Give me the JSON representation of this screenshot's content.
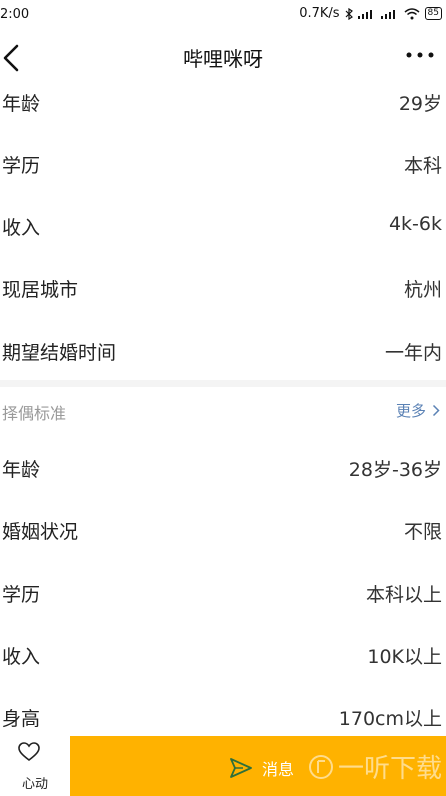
{
  "status_bar": {
    "time": "2:00",
    "network_speed": "0.7K/s",
    "battery": "85"
  },
  "nav": {
    "title": "哔哩咪呀"
  },
  "profile_rows": [
    {
      "label": "年龄",
      "value": "29岁"
    },
    {
      "label": "学历",
      "value": "本科"
    },
    {
      "label": "收入",
      "value": "4k-6k"
    },
    {
      "label": "现居城市",
      "value": "杭州"
    },
    {
      "label": "期望结婚时间",
      "value": "一年内"
    }
  ],
  "preference_section": {
    "title": "择偶标准",
    "more_label": "更多"
  },
  "preference_rows": [
    {
      "label": "年龄",
      "value": "28岁-36岁"
    },
    {
      "label": "婚姻状况",
      "value": "不限"
    },
    {
      "label": "学历",
      "value": "本科以上"
    },
    {
      "label": "收入",
      "value": "10K以上"
    },
    {
      "label": "身高",
      "value": "170cm以上"
    }
  ],
  "bottom_bar": {
    "like_label": "心动",
    "message_label": "消息",
    "watermark_text": "一听下载"
  },
  "colors": {
    "accent": "#ffb200",
    "link": "#5b82b5"
  }
}
